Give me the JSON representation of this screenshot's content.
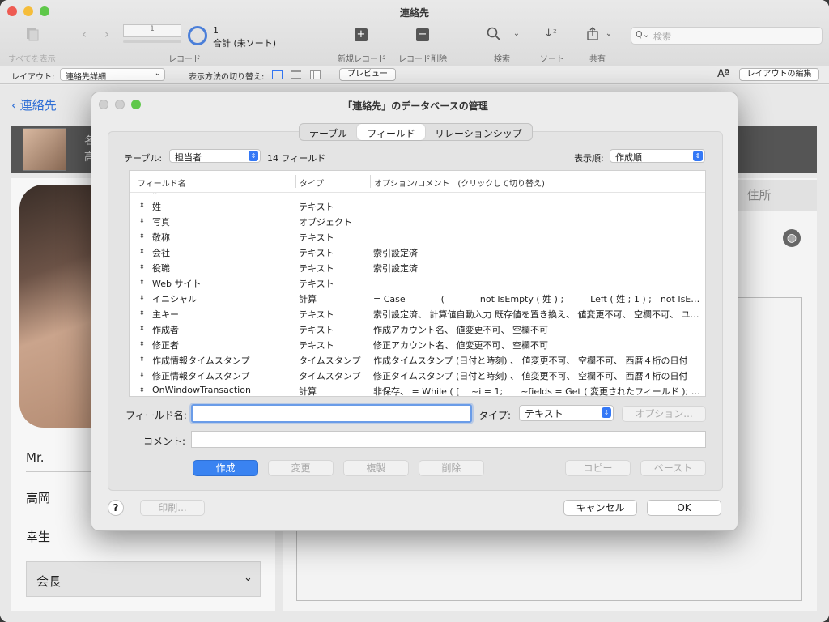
{
  "window": {
    "title": "連絡先"
  },
  "toolbar": {
    "show_all": "すべてを表示",
    "record_label": "レコード",
    "record_number": "1",
    "record_count": "1",
    "record_total": "合計 (未ソート)",
    "new_record": "新規レコード",
    "delete_record": "レコード削除",
    "search": "検索",
    "sort": "ソート",
    "share": "共有",
    "search_placeholder": "検索"
  },
  "layoutbar": {
    "layout_label": "レイアウト:",
    "layout_value": "連絡先詳細",
    "view_label": "表示方法の切り替え:",
    "preview": "プレビュー",
    "edit_layout": "レイアウトの編集",
    "text_size_glyph": "Aª"
  },
  "background": {
    "back_label": "連絡先",
    "name_prefix": "Mr.",
    "last_name": "高岡",
    "first_name": "幸生",
    "title_value": "会長",
    "address_tab": "住所",
    "header_glyph_1": "名",
    "header_glyph_2": "高"
  },
  "dialog": {
    "title": "「連絡先」のデータベースの管理",
    "tabs": [
      "テーブル",
      "フィールド",
      "リレーションシップ"
    ],
    "table_label": "テーブル:",
    "table_value": "担当者",
    "field_count": "14 フィールド",
    "order_label": "表示順:",
    "order_value": "作成順",
    "columns": [
      "フィールド名",
      "タイプ",
      "オプション/コメント　(クリックして切り替え)"
    ],
    "rows": [
      {
        "name": "姓",
        "type": "テキスト",
        "opt": ""
      },
      {
        "name": "写真",
        "type": "オブジェクト",
        "opt": ""
      },
      {
        "name": "敬称",
        "type": "テキスト",
        "opt": ""
      },
      {
        "name": "会社",
        "type": "テキスト",
        "opt": "索引設定済"
      },
      {
        "name": "役職",
        "type": "テキスト",
        "opt": "索引設定済"
      },
      {
        "name": "Web サイト",
        "type": "テキスト",
        "opt": ""
      },
      {
        "name": "イニシャル",
        "type": "計算",
        "opt": "= Case　　　　(　　　　not IsEmpty ( 姓 ) ;　　　Left ( 姓 ; 1 ) ;　not IsE…"
      },
      {
        "name": "主キー",
        "type": "テキスト",
        "opt": "索引設定済、 計算値自動入力 既存値を置き換え、 値変更不可、 空欄不可、 ユニーク…"
      },
      {
        "name": "作成者",
        "type": "テキスト",
        "opt": "作成アカウント名、 値変更不可、 空欄不可"
      },
      {
        "name": "修正者",
        "type": "テキスト",
        "opt": "修正アカウント名、 値変更不可、 空欄不可"
      },
      {
        "name": "作成情報タイムスタンプ",
        "type": "タイムスタンプ",
        "opt": "作成タイムスタンプ (日付と時刻) 、 値変更不可、 空欄不可、 西暦４桁の日付"
      },
      {
        "name": "修正情報タイムスタンプ",
        "type": "タイムスタンプ",
        "opt": "修正タイムスタンプ (日付と時刻) 、 値変更不可、 空欄不可、 西暦４桁の日付"
      },
      {
        "name": "OnWindowTransaction",
        "type": "計算",
        "opt": "非保存、 = While ( [　 ~i = 1;　　~fields = Get ( 変更されたフィールド ); ~filter…"
      }
    ],
    "field_name_label": "フィールド名:",
    "field_name_value": "",
    "type_label": "タイプ:",
    "type_value": "テキスト",
    "options_button": "オプション...",
    "comment_label": "コメント:",
    "comment_value": "",
    "create": "作成",
    "change": "変更",
    "duplicate": "複製",
    "delete": "削除",
    "copy": "コピー",
    "paste": "ペースト",
    "help": "?",
    "print": "印刷...",
    "cancel": "キャンセル",
    "ok": "OK"
  },
  "colors": {
    "accent": "#3a83f1",
    "link": "#2f6fd6"
  }
}
